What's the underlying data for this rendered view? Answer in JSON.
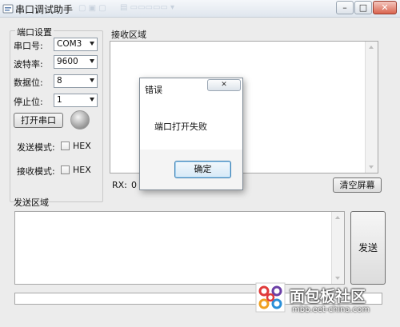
{
  "window": {
    "title": "串口调试助手",
    "colors": {
      "titlebar": "#dfe6ee",
      "close": "#d9644f"
    }
  },
  "serial_settings": {
    "legend": "端口设置",
    "port": {
      "label": "串口号:",
      "value": "COM3"
    },
    "baud": {
      "label": "波特率:",
      "value": "9600"
    },
    "databits": {
      "label": "数据位:",
      "value": "8"
    },
    "stopbits": {
      "label": "停止位:",
      "value": "1"
    },
    "open_button": "打开串口",
    "send_mode": {
      "label": "发送模式:",
      "checkbox": "HEX",
      "checked": false
    },
    "recv_mode": {
      "label": "接收模式:",
      "checkbox": "HEX",
      "checked": false
    }
  },
  "receive": {
    "legend": "接收区域",
    "rx_label": "RX:",
    "rx_value": "0",
    "clear_button": "清空屏幕"
  },
  "send": {
    "legend": "发送区域",
    "send_button": "发送"
  },
  "dialog": {
    "title": "错误",
    "message": "端口打开失败",
    "ok_button": "确定"
  },
  "watermark": {
    "text": "面包板社区",
    "subtext": "mbb.eet-china.com"
  }
}
